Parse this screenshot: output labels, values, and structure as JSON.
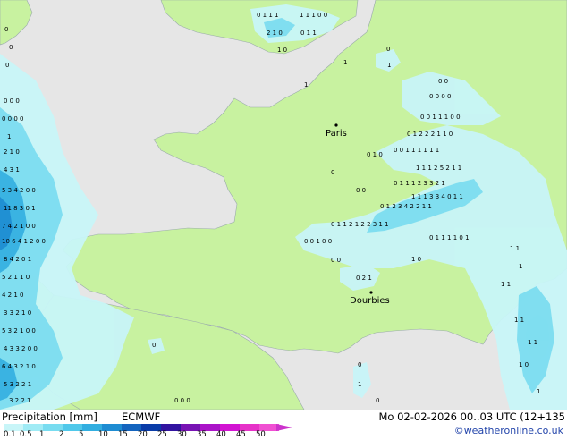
{
  "map": {
    "cities": [
      {
        "name": "Paris"
      },
      {
        "name": "Dourbies"
      }
    ]
  },
  "legend": {
    "title": "Precipitation [mm]",
    "source": "ECMWF",
    "ticks": [
      "0.1",
      "0.5",
      "1",
      "2",
      "5",
      "10",
      "15",
      "20",
      "25",
      "30",
      "35",
      "40",
      "45",
      "50"
    ],
    "colors": [
      "#c8f5f8",
      "#a0ebf5",
      "#78dcf0",
      "#50c8ea",
      "#32aee0",
      "#1e8cd2",
      "#1464be",
      "#0a3ca8",
      "#3214a0",
      "#7814b4",
      "#aa14c8",
      "#d214d2",
      "#e632c8",
      "#f050d2"
    ]
  },
  "footer": {
    "datetime": "Mo 02-02-2026 00..03 UTC (12+135",
    "credit": "©weatheronline.co.uk"
  },
  "colors": {
    "land": "#c8f2a0",
    "sea": "#e6e6e6",
    "precip_light": "#c8f5f8",
    "precip_mid": "#78dcf0",
    "precip_heavy": "#32aee0"
  }
}
